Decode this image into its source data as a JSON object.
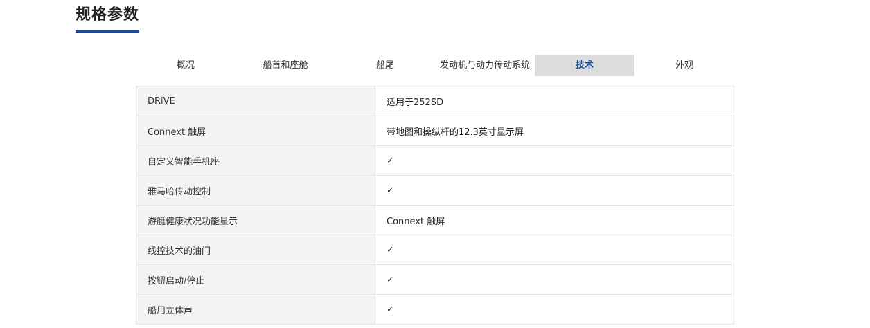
{
  "section_title": "规格参数",
  "tabs": [
    {
      "label": "概况",
      "active": false
    },
    {
      "label": "船首和座舱",
      "active": false
    },
    {
      "label": "船尾",
      "active": false
    },
    {
      "label": "发动机与动力传动系统",
      "active": false
    },
    {
      "label": "技术",
      "active": true
    },
    {
      "label": "外观",
      "active": false
    }
  ],
  "colors": {
    "accent": "#1a4c93",
    "active_tab_bg": "#dcdcdc",
    "label_cell_bg": "#f4f4f4",
    "border": "#e4e4e4"
  },
  "specs": [
    {
      "label": "DRiVE",
      "value": "适用于252SD"
    },
    {
      "label": "Connext 触屏",
      "value": "带地图和操纵杆的12.3英寸显示屏"
    },
    {
      "label": "自定义智能手机座",
      "value": "✓"
    },
    {
      "label": "雅马哈传动控制",
      "value": "✓"
    },
    {
      "label": "游艇健康状况功能显示",
      "value": "Connext 触屏"
    },
    {
      "label": "线控技术的油门",
      "value": "✓"
    },
    {
      "label": "按钮启动/停止",
      "value": "✓"
    },
    {
      "label": "船用立体声",
      "value": "✓"
    }
  ]
}
